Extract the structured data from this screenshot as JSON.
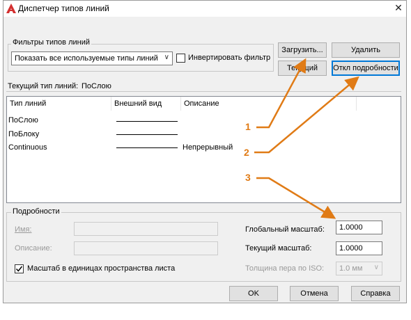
{
  "window": {
    "title": "Диспетчер типов линий",
    "close_glyph": "✕"
  },
  "filters": {
    "group_label": "Фильтры типов линий",
    "combo_value": "Показать все используемые типы линий",
    "invert_label": "Инвертировать фильтр",
    "invert_checked": false
  },
  "buttons": {
    "load": "Загрузить...",
    "delete": "Удалить",
    "current": "Текущий",
    "details": "Откл подробности",
    "ok": "OK",
    "cancel": "Отмена",
    "help": "Справка"
  },
  "current_linetype": {
    "label": "Текущий тип линий:",
    "value": "ПоСлою"
  },
  "table": {
    "columns": [
      "Тип линий",
      "Внешний вид",
      "Описание"
    ],
    "rows": [
      {
        "name": "ПоСлою",
        "description": ""
      },
      {
        "name": "ПоБлоку",
        "description": ""
      },
      {
        "name": "Continuous",
        "description": "Непрерывный"
      }
    ]
  },
  "details": {
    "group_label": "Подробности",
    "name_label": "Имя:",
    "description_label": "Описание:",
    "paper_space_label": "Масштаб в единицах пространства листа",
    "paper_space_checked": true,
    "global_scale_label": "Глобальный масштаб:",
    "global_scale_value": "1.0000",
    "current_scale_label": "Текущий масштаб:",
    "current_scale_value": "1.0000",
    "pen_width_label": "Толщина пера по ISO:",
    "pen_width_value": "1.0 мм"
  },
  "callouts": [
    "1",
    "2",
    "3"
  ],
  "colors": {
    "callout": "#e07b16",
    "focus": "#0078d7",
    "app_icon": "#d32f2f"
  }
}
